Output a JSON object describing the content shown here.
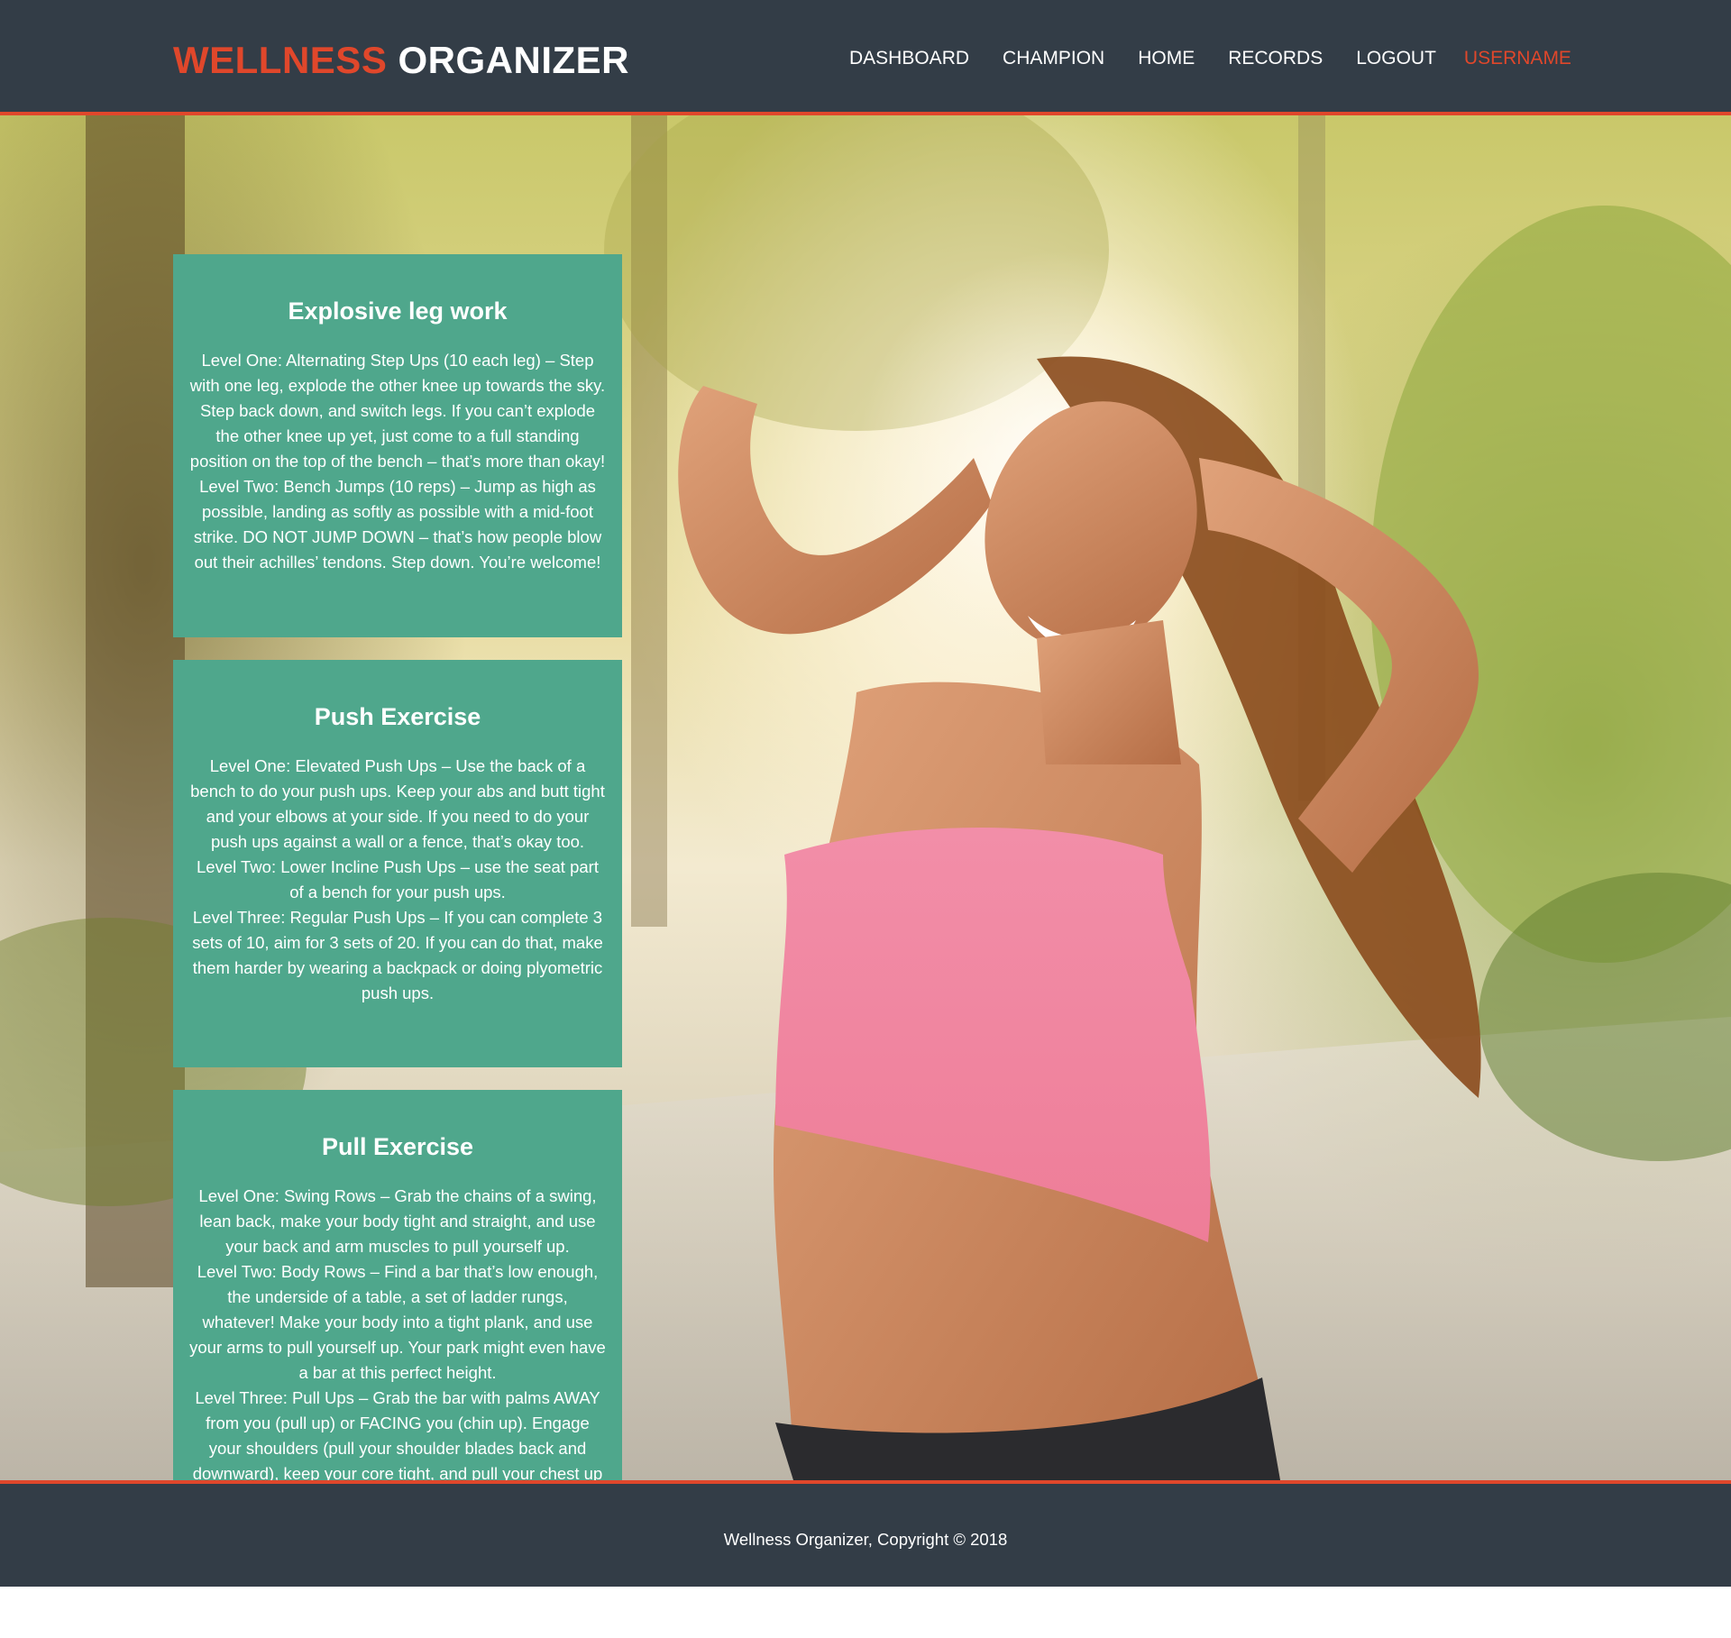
{
  "header": {
    "logo_part1": "WELLNESS",
    "logo_part2": "ORGANIZER",
    "nav": [
      "DASHBOARD",
      "CHAMPION",
      "HOME",
      "RECORDS",
      "LOGOUT"
    ],
    "username": "USERNAME"
  },
  "cards": [
    {
      "title": "Explosive leg work",
      "paragraphs": [
        "Level One: Alternating Step Ups (10 each leg) – Step with one leg, explode the other knee up towards the sky. Step back down, and switch legs. If you can’t explode the other knee up yet, just come to a full standing position on the top of the bench – that’s more than okay!",
        "Level Two: Bench Jumps (10 reps) – Jump as high as possible, landing as softly as possible with a mid-foot strike. DO NOT JUMP DOWN – that’s how people blow out their achilles’ tendons. Step down. You’re welcome!"
      ]
    },
    {
      "title": "Push Exercise",
      "paragraphs": [
        "Level One: Elevated Push Ups – Use the back of a bench to do your push ups. Keep your abs and butt tight and your elbows at your side. If you need to do your push ups against a wall or a fence, that’s okay too.",
        "Level Two: Lower Incline Push Ups – use the seat part of a bench for your push ups.",
        "Level Three: Regular Push Ups – If you can complete 3 sets of 10, aim for 3 sets of 20. If you can do that, make them harder by wearing a backpack or doing plyometric push ups."
      ]
    },
    {
      "title": "Pull Exercise",
      "paragraphs": [
        "Level One: Swing Rows – Grab the chains of a swing, lean back, make your body tight and straight, and use your back and arm muscles to pull yourself up.",
        "Level Two: Body Rows – Find a bar that’s low enough, the underside of a table, a set of ladder rungs, whatever! Make your body into a tight plank, and use your arms to pull yourself up. Your park might even have a bar at this perfect height.",
        "Level Three: Pull Ups – Grab the bar with palms AWAY from you (pull up) or FACING you (chin up). Engage your shoulders (pull your shoulder blades back and downward), keep your core tight, and pull your chest up towards the bar. If these are too tough, do NEGATIVES – jump above the bar, and lower yourself slowly."
      ]
    }
  ],
  "footer": {
    "copyright": "Wellness Organizer, Copyright © 2018"
  },
  "colors": {
    "header_bg": "#333d47",
    "accent": "#e0472b",
    "card_bg": "#4fa78c",
    "text_light": "#ffffff"
  },
  "hero_image": "woman-stretching-outdoors-photo"
}
